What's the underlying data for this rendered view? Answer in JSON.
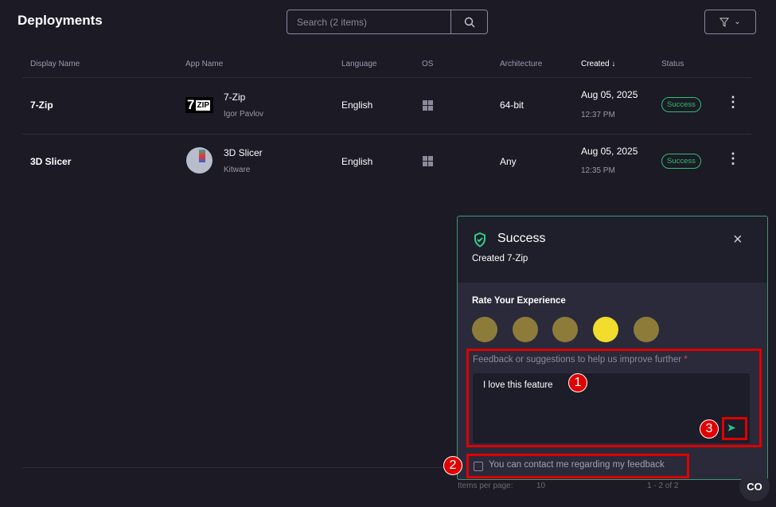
{
  "header": {
    "title": "Deployments",
    "search_placeholder": "Search (2 items)"
  },
  "table": {
    "columns": [
      "Display Name",
      "App Name",
      "Language",
      "OS",
      "Architecture",
      "Created",
      "Status"
    ],
    "rows": [
      {
        "display_name": "7-Zip",
        "app_name": "7-Zip",
        "publisher": "Igor Pavlov",
        "language": "English",
        "os": "windows-icon",
        "architecture": "64-bit",
        "date": "Aug 05, 2025",
        "time": "12:37 PM",
        "status": "Success"
      },
      {
        "display_name": "3D Slicer",
        "app_name": "3D Slicer",
        "publisher": "Kitware",
        "language": "English",
        "os": "windows-icon",
        "architecture": "Any",
        "date": "Aug 05, 2025",
        "time": "12:35 PM",
        "status": "Success"
      }
    ]
  },
  "footer": {
    "items_per_page_label": "Items per page:",
    "items_per_page": "10",
    "range": "1 - 2 of 2"
  },
  "toast": {
    "title": "Success",
    "message": "Created 7-Zip",
    "rate_label": "Rate Your Experience",
    "selected_rating": 4,
    "feedback_label": "Feedback or suggestions to help us improve further",
    "required_mark": "*",
    "feedback_value": "I love this feature",
    "contact_label": "You can contact me regarding my feedback",
    "contact_checked": false
  },
  "annotations": [
    "1",
    "2",
    "3"
  ],
  "fab_label": "CO",
  "colors": {
    "accent": "#2fbf71",
    "annotation": "#e00000"
  }
}
